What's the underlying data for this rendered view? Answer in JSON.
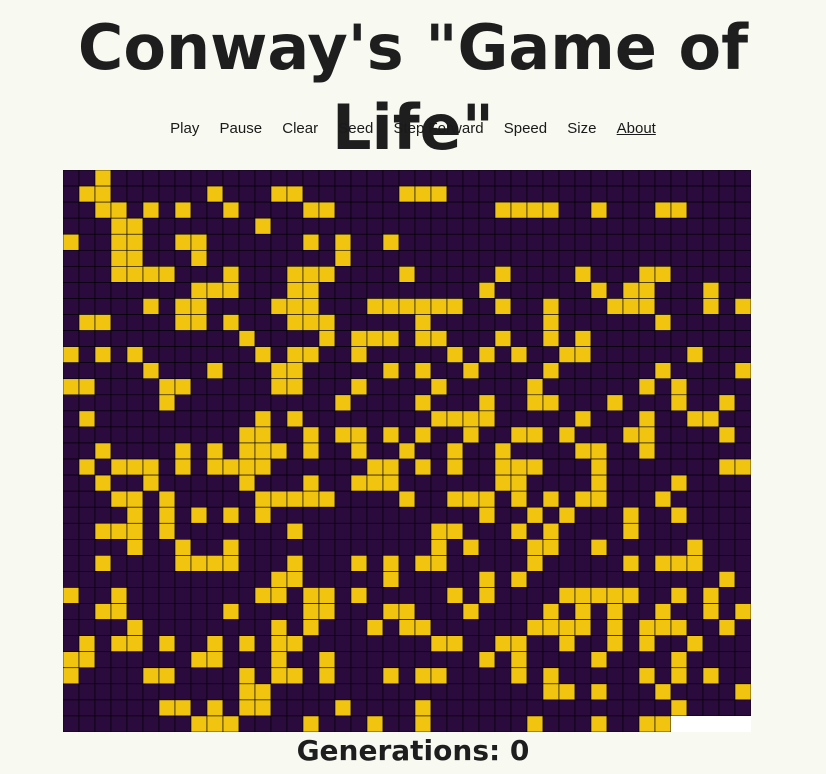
{
  "title": "Conway's \"Game of Life\"",
  "nav": {
    "play": "Play",
    "pause": "Pause",
    "clear": "Clear",
    "seed": "Seed",
    "step_forward": "Step Forward",
    "speed": "Speed",
    "size": "Size",
    "about": "About"
  },
  "generations_label": "Generations: 0",
  "colors": {
    "alive": "#f1c40f",
    "dead": "#2b0a3d",
    "gridline": "#000000"
  },
  "grid": {
    "cols": 43,
    "rows": 35,
    "cells": [
      "00200000000000000000000000000000000000000000000000",
      "0110000001000110000001110000000000000000000000001",
      "0011010100100001100000000001111001000110000010",
      "0001100000001000000000000000000000000000000000000",
      "1001100110000001010010000000000000000000000000000",
      "0001100010000000010000000000000000000000000000000"
    ]
  }
}
